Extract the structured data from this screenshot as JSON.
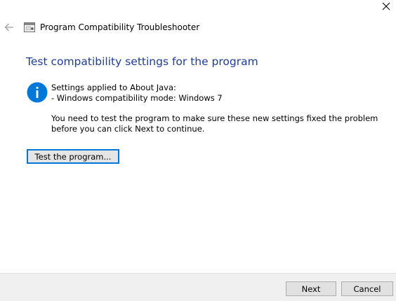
{
  "window": {
    "title": "Program Compatibility Troubleshooter"
  },
  "icons": {
    "close": "close-icon",
    "back": "back-arrow-icon",
    "app": "troubleshooter-app-icon",
    "info": "info-icon"
  },
  "content": {
    "heading": "Test compatibility settings for the program",
    "settings_applied": "Settings applied to About Java:",
    "compat_mode": "- Windows compatibility mode: Windows 7",
    "note": "You need to test the program to make sure these new settings fixed the problem before you can click Next to continue.",
    "test_button_label": "Test the program..."
  },
  "footer": {
    "next_label": "Next",
    "cancel_label": "Cancel"
  },
  "colors": {
    "heading": "#1f3d99",
    "info_icon": "#0078d7",
    "focus_border": "#0078d7",
    "footer_bg": "#f0f0f0"
  }
}
